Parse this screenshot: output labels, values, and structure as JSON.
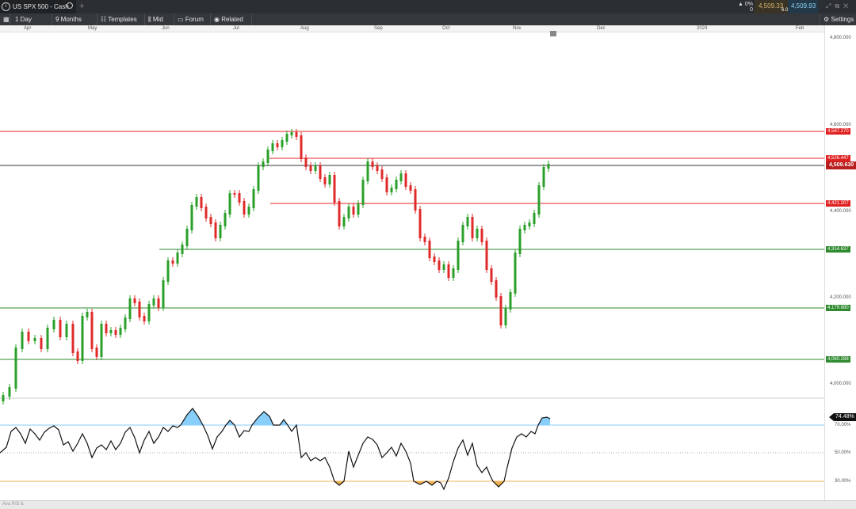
{
  "header": {
    "instrument": "US SPX 500 - Cash",
    "new_tab": "+",
    "change_pct": "0%",
    "change_val": "0",
    "sell_price": "4,509.33",
    "spread": "6.0",
    "buy_price": "4,509.93"
  },
  "toolbar": {
    "interval": "1 Day",
    "range": "9 Months",
    "templates": "Templates",
    "price_type": "Mid",
    "forum": "Forum",
    "related": "Related",
    "settings": "Settings"
  },
  "months": [
    "Apr",
    "May",
    "Jun",
    "Jul",
    "Aug",
    "Sep",
    "Oct",
    "Nov",
    "Dec",
    "2024",
    "Feb"
  ],
  "price_axis": [
    "4,800.000",
    "4,600.000",
    "4,400.000",
    "4,200.000",
    "4,000.000"
  ],
  "rsi_axis": [
    "70.00%",
    "50.00%",
    "30.00%"
  ],
  "current_price": "4,509.630",
  "rsi_value": "74.48%",
  "levels": [
    {
      "label": "4,587.270",
      "color": "#e02020"
    },
    {
      "label": "4,526.447",
      "color": "#e02020"
    },
    {
      "label": "4,421.207",
      "color": "#e02020"
    },
    {
      "label": "4,314.637",
      "color": "#2d8a2d"
    },
    {
      "label": "4,179.880",
      "color": "#2d8a2d"
    },
    {
      "label": "4,060.288",
      "color": "#2d8a2d"
    }
  ],
  "colors": {
    "up": "#2aa02a",
    "down": "#e02a2a",
    "rsi_fill": "#87cefa"
  },
  "bottom_note": "Ava RI3 &"
}
